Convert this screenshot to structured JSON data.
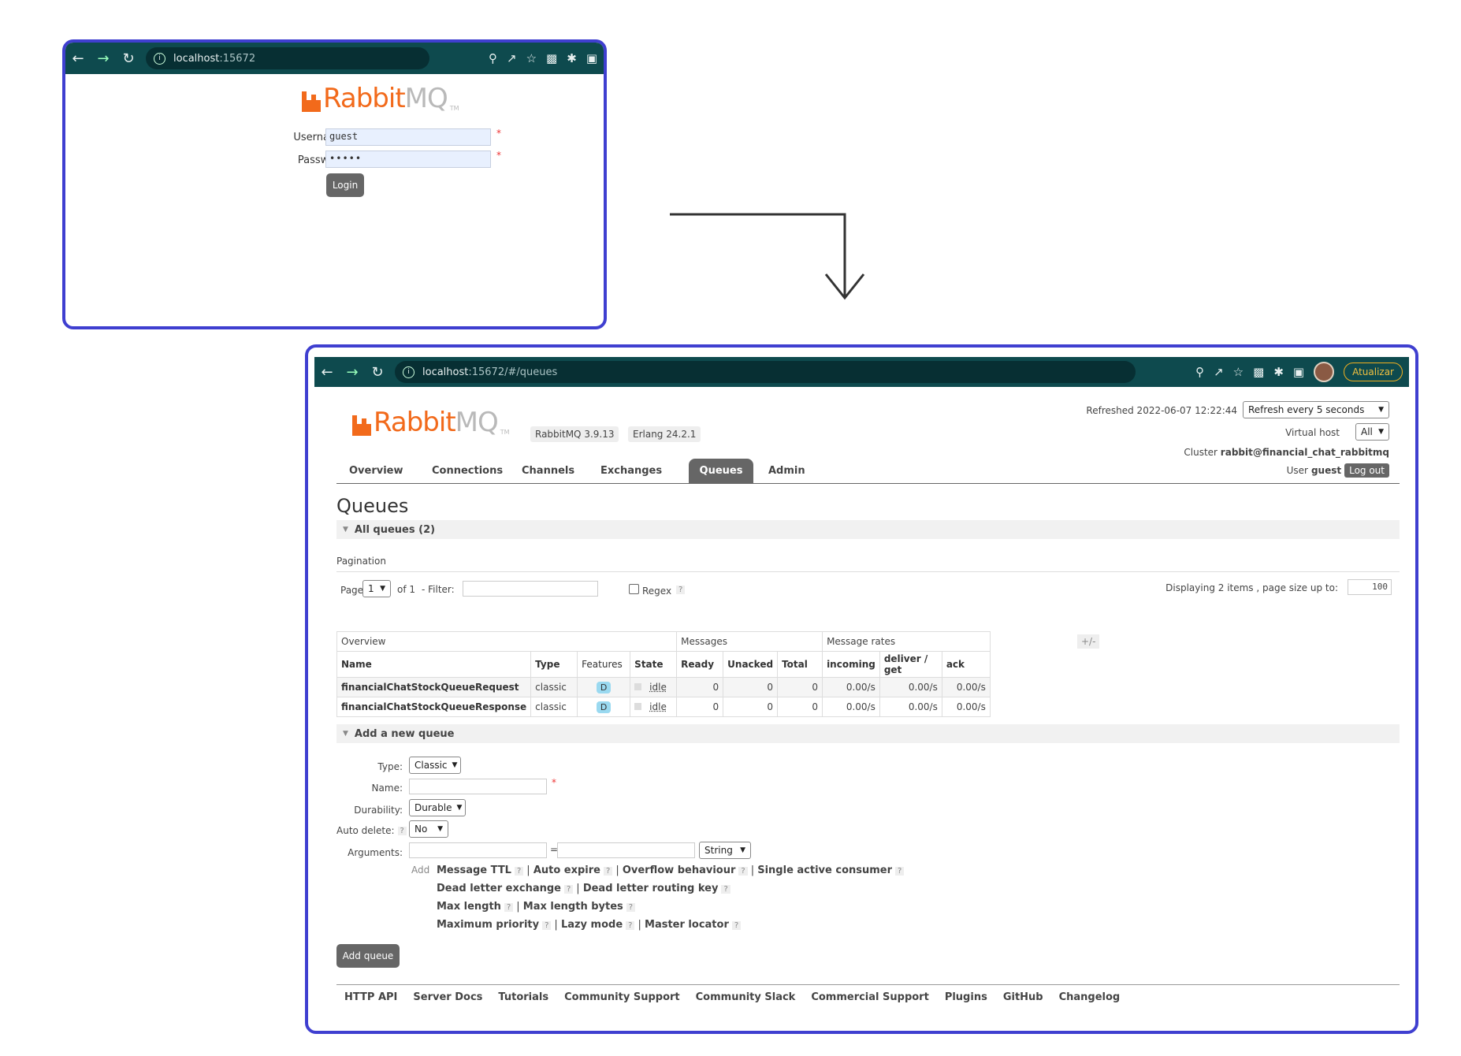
{
  "login_window": {
    "url_host": "localhost",
    "url_rest": ":15672",
    "logo_word1": "Rabbit",
    "logo_word2": "MQ",
    "logo_tm": "TM",
    "username_label": "Username:",
    "username_value": "guest",
    "password_label": "Password:",
    "password_value": "•••••",
    "required_mark": "*",
    "login_button": "Login"
  },
  "queues_window": {
    "url_host": "localhost",
    "url_rest": ":15672/#/queues",
    "update_button": "Atualizar",
    "logo_word1": "Rabbit",
    "logo_word2": "MQ",
    "logo_tm": "TM",
    "version": "RabbitMQ 3.9.13",
    "erlang": "Erlang 24.2.1",
    "refreshed": "Refreshed 2022-06-07 12:22:44",
    "refresh_select": "Refresh every 5 seconds",
    "vhost_label": "Virtual host",
    "vhost_value": "All",
    "cluster_label": "Cluster",
    "cluster_value": "rabbit@financial_chat_rabbitmq",
    "user_label": "User",
    "user_value": "guest",
    "logout": "Log out",
    "tabs": [
      "Overview",
      "Connections",
      "Channels",
      "Exchanges",
      "Queues",
      "Admin"
    ],
    "page_title": "Queues",
    "all_queues": "All queues (2)",
    "pagination_label": "Pagination",
    "page_label": "Page",
    "page_value": "1",
    "of_label": "of 1",
    "filter_label": "- Filter:",
    "regex_label": "Regex",
    "help": "?",
    "displaying": "Displaying 2 items , page size up to:",
    "page_size": "100",
    "table": {
      "group_headers": [
        "Overview",
        "Messages",
        "Message rates"
      ],
      "plus_minus": "+/-",
      "columns": [
        "Name",
        "Type",
        "Features",
        "State",
        "Ready",
        "Unacked",
        "Total",
        "incoming",
        "deliver / get",
        "ack"
      ],
      "rows": [
        {
          "name": "financialChatStockQueueRequest",
          "type": "classic",
          "features": "D",
          "state": "idle",
          "ready": "0",
          "unacked": "0",
          "total": "0",
          "incoming": "0.00/s",
          "deliver": "0.00/s",
          "ack": "0.00/s"
        },
        {
          "name": "financialChatStockQueueResponse",
          "type": "classic",
          "features": "D",
          "state": "idle",
          "ready": "0",
          "unacked": "0",
          "total": "0",
          "incoming": "0.00/s",
          "deliver": "0.00/s",
          "ack": "0.00/s"
        }
      ]
    },
    "add_queue_section": "Add a new queue",
    "form": {
      "type_label": "Type:",
      "type_value": "Classic",
      "name_label": "Name:",
      "durability_label": "Durability:",
      "durability_value": "Durable",
      "auto_delete_label": "Auto delete:",
      "auto_delete_value": "No",
      "arguments_label": "Arguments:",
      "equals": "=",
      "arg_type": "String",
      "add_label": "Add",
      "separator": "|",
      "arg_links": [
        "Message TTL",
        "Auto expire",
        "Overflow behaviour",
        "Single active consumer",
        "Dead letter exchange",
        "Dead letter routing key",
        "Max length",
        "Max length bytes",
        "Maximum priority",
        "Lazy mode",
        "Master locator"
      ],
      "add_button": "Add queue"
    },
    "footer_links": [
      "HTTP API",
      "Server Docs",
      "Tutorials",
      "Community Support",
      "Community Slack",
      "Commercial Support",
      "Plugins",
      "GitHub",
      "Changelog"
    ]
  }
}
